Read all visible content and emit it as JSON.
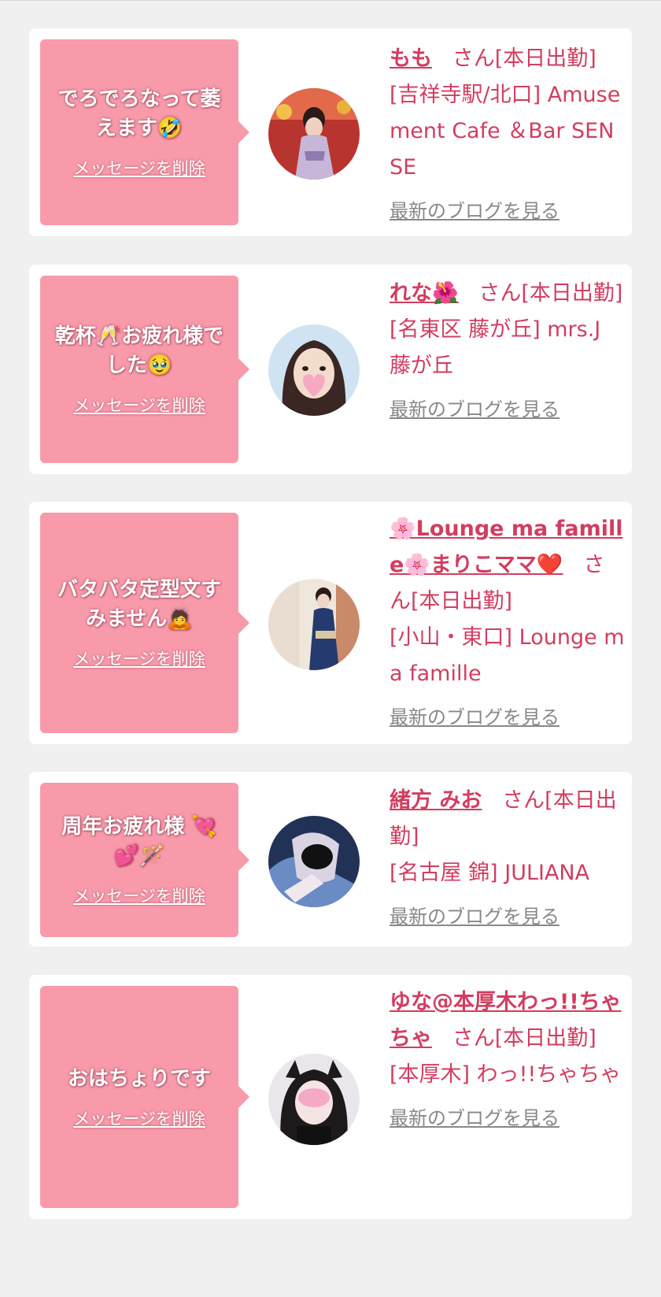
{
  "entries": [
    {
      "message": "でろでろなって萎えます🤣",
      "delete_label": "メッセージを削除",
      "name": "もも",
      "suffix": "さん[本日出勤]",
      "shop": "[吉祥寺駅/北口] Amusement Cafe ＆Bar SENSE",
      "blog_label": "最新のブログを見る"
    },
    {
      "message": "乾杯🥂お疲れ様でした🥹",
      "delete_label": "メッセージを削除",
      "name": "れな🌺",
      "suffix": "さん[本日出勤]",
      "shop": "[名東区 藤が丘] mrs.J 藤が丘",
      "blog_label": "最新のブログを見る"
    },
    {
      "message": "バタバタ定型文すみません🙇",
      "delete_label": "メッセージを削除",
      "name": "🌸Lounge ma famille🌸まりこママ❤️",
      "suffix": "さん[本日出勤]",
      "shop": "[小山・東口] Lounge ma famille",
      "blog_label": "最新のブログを見る"
    },
    {
      "message": "周年お疲れ様 💘💕🪄",
      "delete_label": "メッセージを削除",
      "name": "緒方 みお",
      "suffix": "さん[本日出勤]",
      "shop": "[名古屋 錦] JULIANA",
      "blog_label": "最新のブログを見る"
    },
    {
      "message": "おはちょりです",
      "delete_label": "メッセージを削除",
      "name": "ゆな@本厚木わっ!!ちゃちゃ",
      "suffix": "さん[本日出勤]",
      "shop": "[本厚木] わっ!!ちゃちゃ",
      "blog_label": "最新のブログを見る"
    }
  ],
  "colors": {
    "bubble": "#f89aaa",
    "accent_text": "#d23d60",
    "link_gray": "#888888",
    "card": "#ffffff",
    "page_bg": "#f0f0f0"
  }
}
